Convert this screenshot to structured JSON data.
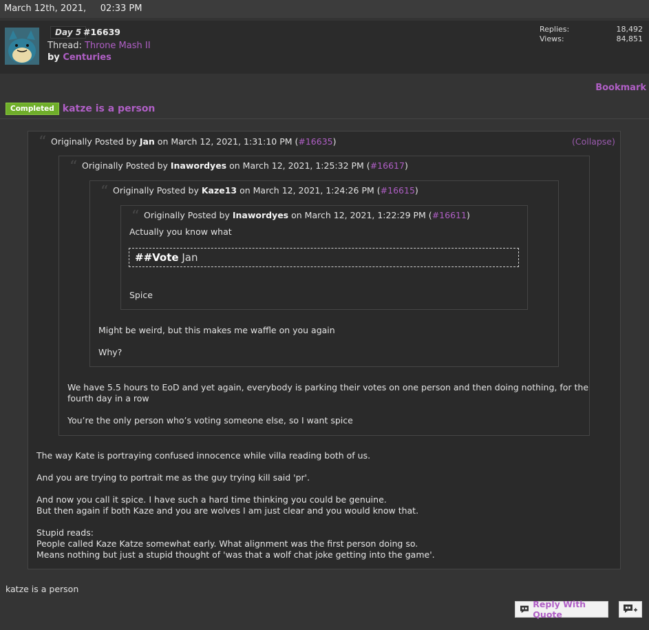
{
  "post": {
    "date": "March 12th, 2021,     02:33 PM",
    "day_badge": "Day 5",
    "number": "#16639",
    "thread_label": "Thread:",
    "thread_name": "Throne Mash II",
    "by_label": "by",
    "author": "Centuries",
    "stats": {
      "replies_label": "Replies:",
      "replies_value": "18,492",
      "views_label": "Views:",
      "views_value": "84,851"
    },
    "bookmark": "Bookmark",
    "status_badge": "Completed",
    "title": "katze is a person"
  },
  "quotes": {
    "q1": {
      "prefix": "Originally Posted by ",
      "user": "Jan",
      "middle": " on March 12, 2021, 1:31:10 PM (",
      "ref": "#16635",
      "suffix": ")",
      "collapse": "(Collapse)"
    },
    "q2": {
      "prefix": "Originally Posted by ",
      "user": "Inawordyes",
      "middle": " on March 12, 2021, 1:25:32 PM (",
      "ref": "#16617",
      "suffix": ")"
    },
    "q3": {
      "prefix": "Originally Posted by ",
      "user": "Kaze13",
      "middle": " on March 12, 2021, 1:24:26 PM (",
      "ref": "#16615",
      "suffix": ")"
    },
    "q4": {
      "prefix": "Originally Posted by ",
      "user": "Inawordyes",
      "middle": " on March 12, 2021, 1:22:29 PM (",
      "ref": "#16611",
      "suffix": ")"
    }
  },
  "q4_body": {
    "line1": "Actually you know what",
    "vote_tag": "##Vote",
    "vote_name": "Jan",
    "line2": "Spice"
  },
  "q3_body": {
    "line1": "Might be weird, but this makes me waffle on you again",
    "line2": "Why?"
  },
  "q2_body": {
    "line1": "We have 5.5 hours to EoD and yet again, everybody is parking their votes on one person and then doing nothing, for the",
    "line2": "fourth day in a row",
    "line3": "You’re the only person who’s voting someone else, so I want spice"
  },
  "q1_body": {
    "p1": "The way Kate is portraying confused innocence while villa reading both of us.",
    "p2": "And you are trying to portrait me as the guy trying kill said 'pr'.",
    "p3a": "And now you call it spice. I have such a hard time thinking you could be genuine.",
    "p3b": "But then again if both Kaze and you are wolves I am just clear and you would know that.",
    "p4a": "Stupid reads:",
    "p4b": "People called Kaze Katze somewhat early. What alignment was the first person doing so.",
    "p4c": "Means nothing but just a stupid thought of 'was that a wolf chat joke getting into the game'."
  },
  "post_body": "katze is a person",
  "actions": {
    "reply_with_quote": "Reply With Quote"
  },
  "icons": [
    "avatar",
    "quote-mark-icon",
    "reply-icon",
    "multi-quote-icon"
  ]
}
